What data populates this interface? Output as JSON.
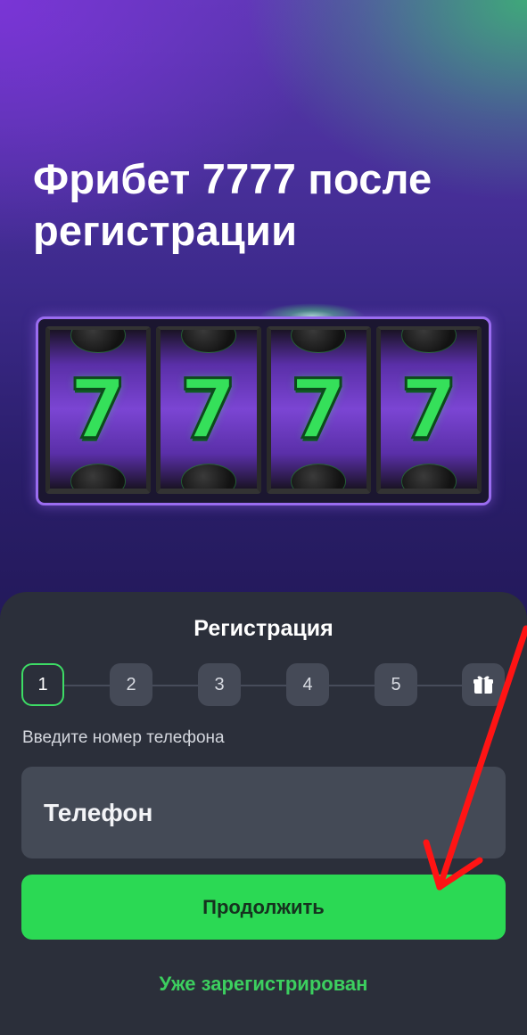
{
  "hero": {
    "title": "Фрибет 7777 после регистрации",
    "reels": [
      {
        "symbol": "7",
        "top_icon": "hockey-puck-icon",
        "bottom_icon": "hockey-puck-icon"
      },
      {
        "symbol": "7",
        "top_icon": "hockey-puck-icon",
        "bottom_icon": "soccer-ball-icon"
      },
      {
        "symbol": "7",
        "top_icon": "soccer-ball-icon",
        "bottom_icon": "basketball-icon"
      },
      {
        "symbol": "7",
        "top_icon": "basketball-icon",
        "bottom_icon": "hockey-puck-icon"
      }
    ]
  },
  "registration": {
    "title": "Регистрация",
    "steps": [
      "1",
      "2",
      "3",
      "4",
      "5"
    ],
    "active_step": 1,
    "final_step_icon": "gift-icon",
    "hint": "Введите номер телефона",
    "phone_placeholder": "Телефон",
    "continue_label": "Продолжить",
    "login_link": "Уже зарегистрирован"
  },
  "colors": {
    "accent_green": "#2bd954",
    "sheet_bg": "#2b2f3a",
    "input_bg": "#444a56",
    "annotation_arrow": "#ff1414"
  }
}
